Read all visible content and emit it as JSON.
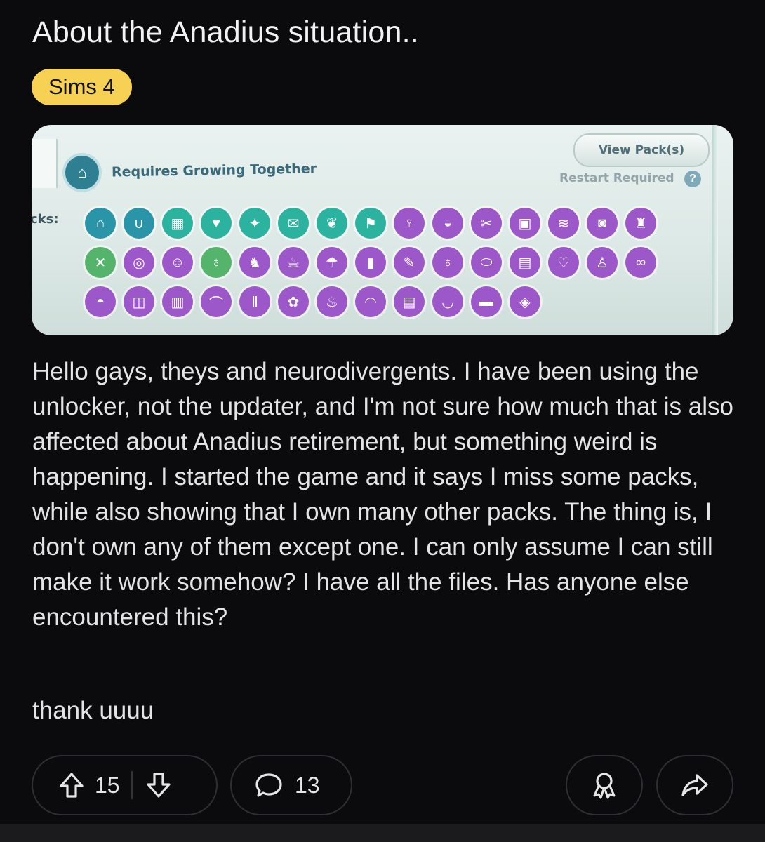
{
  "post": {
    "title": "About the Anadius situation..",
    "flair": "Sims 4",
    "body": "Hello gays, theys and neurodivergents. I have been using the unlocker, not the updater, and I'm not sure how much that is also affected about Anadius retirement, but something weird is happening. I started the game and it says I miss some packs, while also showing that I own many other packs. The thing is, I don't own any of them except one. I can only assume I can still make it work somehow? I have all the files. Has anyone else encountered this?",
    "signoff": "thank uuuu"
  },
  "screenshot": {
    "requires_text": "Requires Growing Together",
    "view_packs_label": "View Pack(s)",
    "restart_text": "Restart Required",
    "packs_label": "cks:"
  },
  "actions": {
    "upvotes": "15",
    "comments": "13",
    "icons": [
      "upvote-icon",
      "downvote-icon",
      "comment-icon",
      "award-icon",
      "share-icon"
    ]
  },
  "colors": {
    "background": "#0b0b0d",
    "flair": "#f7d153",
    "pill_border": "#2f2f33"
  }
}
